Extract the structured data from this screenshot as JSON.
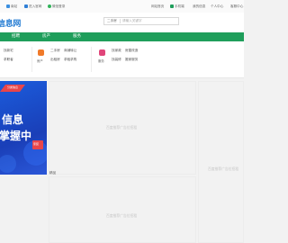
{
  "topbar": {
    "left_link_1": "南站",
    "left_link_2": "进入官网",
    "left_link_3": "微信登录",
    "right_link_1": "网站首页",
    "right_link_2": "手机端",
    "right_link_3": "我的信息",
    "right_link_4": "个人中心",
    "right_link_5": "客服中心"
  },
  "header": {
    "logo_text": "信息网",
    "search_select": "二手房",
    "search_placeholder": "请输入关键字"
  },
  "nav": {
    "items": [
      "招聘",
      "房产",
      "服务"
    ]
  },
  "categories": {
    "left": {
      "links": [
        "找新宅",
        "求职者"
      ]
    },
    "mid": {
      "label": "房产",
      "links": [
        "二手房",
        "商铺转让",
        "出租房",
        "求租求购"
      ]
    },
    "right": {
      "label": "服务",
      "links": [
        "找家政",
        "房屋改造",
        "找装修",
        "搬家服务"
      ]
    }
  },
  "banner": {
    "line1": "信息",
    "line2": "掌握中",
    "badge": "分类信息",
    "tag": "家装"
  },
  "ads": {
    "text1": "百度推荐广告位招租",
    "text2": "百度推荐广告位招租",
    "text3": "百度推荐广告位招租"
  },
  "section_label": "精品",
  "colors": {
    "nav_green": "#1f9e5b",
    "logo_blue": "#2a7fd4",
    "banner_blue": "#1a4fd0"
  }
}
